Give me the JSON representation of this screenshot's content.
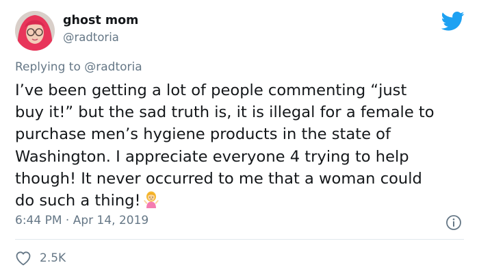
{
  "author": {
    "name": "ghost mom",
    "handle": "@radtoria"
  },
  "reply": {
    "prefix": "Replying to",
    "handle": "@radtoria"
  },
  "tweet": {
    "lines": [
      "I’ve been getting a lot of people commenting “just",
      "buy it!” but the sad truth is, it is illegal for a female to",
      "purchase men’s hygiene products in the state of",
      "Washington. I appreciate everyone 4 trying to help",
      "though! It never occurred to me that a woman could",
      "do such a thing!"
    ],
    "emoji": "woman-shrugging-emoji"
  },
  "meta": {
    "timestamp": "6:44 PM · Apr 14, 2019"
  },
  "actions": {
    "like_count": "2.5K"
  },
  "icons": {
    "brand": "twitter-bird-icon",
    "info": "info-icon",
    "like": "heart-icon"
  },
  "colors": {
    "twitter_blue": "#1da1f2",
    "text": "#14171a",
    "secondary": "#657786",
    "divider": "#e1e8ed"
  }
}
